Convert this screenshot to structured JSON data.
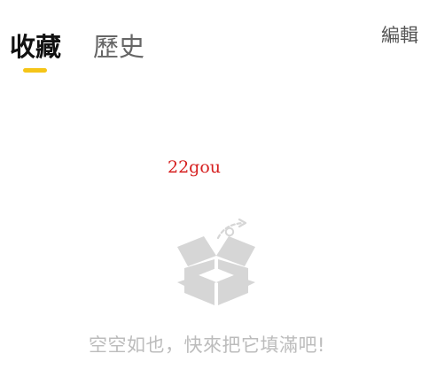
{
  "tabs": {
    "favorites_label": "收藏",
    "history_label": "歷史",
    "active": "favorites"
  },
  "toolbar": {
    "edit_label": "編輯"
  },
  "watermark": {
    "text": "22gou"
  },
  "empty_state": {
    "icon": "empty-box-icon",
    "message": "空空如也，快來把它填滿吧!"
  },
  "colors": {
    "accent": "#f5c518",
    "active_tab_text": "#111111",
    "inactive_tab_text": "#666666",
    "empty_text": "#bcbcbc",
    "icon_gray": "#d6d6d6",
    "watermark": "#d62020"
  }
}
